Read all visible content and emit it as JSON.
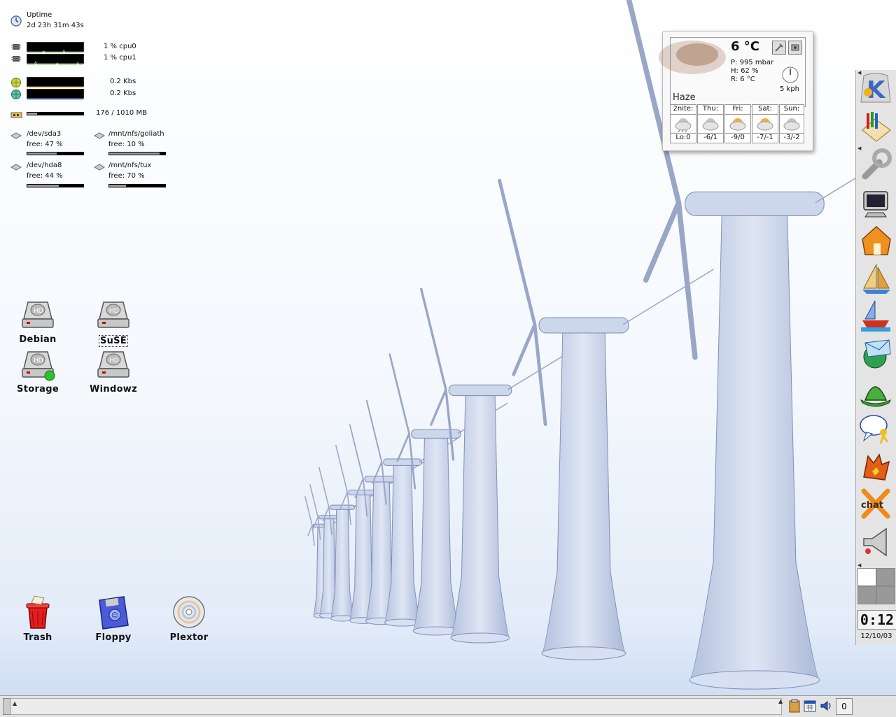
{
  "sysmon": {
    "uptime_label": "Uptime",
    "uptime_value": "2d 23h 31m 43s",
    "cpu": [
      {
        "label": "1 % cpu0"
      },
      {
        "label": "1 % cpu1"
      }
    ],
    "net": [
      {
        "label": "0.2 Kbs"
      },
      {
        "label": "0.2 Kbs"
      }
    ],
    "memory": {
      "label": "176 / 1010 MB",
      "fraction": 0.17
    },
    "disks": [
      {
        "name": "/dev/sda3",
        "free": "free: 47 %",
        "used_fraction": 0.53
      },
      {
        "name": "/mnt/nfs/goliath",
        "free": "free: 10 %",
        "used_fraction": 0.9
      },
      {
        "name": "/dev/hda8",
        "free": "free: 44 %",
        "used_fraction": 0.56
      },
      {
        "name": "/mnt/nfs/tux",
        "free": "free: 70 %",
        "used_fraction": 0.3
      }
    ]
  },
  "desktop_icons": {
    "debian": "Debian",
    "suse": "SuSE",
    "storage": "Storage",
    "windowz": "Windowz",
    "trash": "Trash",
    "floppy": "Floppy",
    "plextor": "Plextor"
  },
  "weather": {
    "temp": "6 °C",
    "pressure": "P: 995 mbar",
    "humidity": "H: 62 %",
    "real": "R: 6 °C",
    "wind": "5 kph",
    "condition": "Haze",
    "forecast": [
      {
        "day": "2nite:",
        "temp": "Lo:0"
      },
      {
        "day": "Thu:",
        "temp": "-6/1"
      },
      {
        "day": "Fri:",
        "temp": "-9/0"
      },
      {
        "day": "Sat:",
        "temp": "-7/-1"
      },
      {
        "day": "Sun:",
        "temp": "-3/-2"
      }
    ]
  },
  "panel": {
    "clock": "0:12",
    "date": "12/10/03"
  },
  "taskbar": {
    "counter": "0"
  },
  "colors": {
    "accent_orange": "#f08a1a",
    "turbine": "#c7d2e8",
    "graph_line": "#5ad040"
  }
}
